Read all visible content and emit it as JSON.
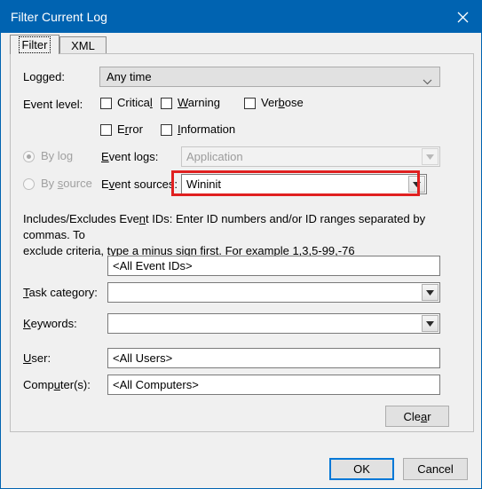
{
  "window": {
    "title": "Filter Current Log",
    "close_icon": "close-icon",
    "accent_color": "#0063b1"
  },
  "tabs": [
    {
      "label": "Filter",
      "active": true
    },
    {
      "label": "XML",
      "active": false
    }
  ],
  "form": {
    "logged": {
      "label": "Logged:",
      "value": "Any time",
      "chevron_icon": "chevron-down-icon"
    },
    "event_level": {
      "label": "Event level:",
      "options": [
        {
          "label": "Critical",
          "accel": "l",
          "checked": false
        },
        {
          "label": "Warning",
          "accel": "W",
          "checked": false
        },
        {
          "label": "Verbose",
          "accel": "b",
          "checked": false
        },
        {
          "label": "Error",
          "accel": "r",
          "checked": false
        },
        {
          "label": "Information",
          "accel": "I",
          "checked": false
        }
      ]
    },
    "source_mode": {
      "by_log": {
        "label": "By log",
        "accel": "g",
        "selected": true,
        "disabled": true
      },
      "by_source": {
        "label": "By source",
        "accel": "s",
        "selected": false,
        "disabled": true
      }
    },
    "event_logs": {
      "label": "Event logs:",
      "accel": "E",
      "value": "Application",
      "disabled": true,
      "dropdown_icon": "dropdown-arrow-icon"
    },
    "event_sources": {
      "label": "Event sources:",
      "accel": "v",
      "value": "Wininit",
      "disabled": false,
      "dropdown_icon": "dropdown-arrow-icon",
      "highlight_color": "#e02020"
    },
    "event_ids": {
      "description_line1": "Includes/Excludes Event IDs: Enter ID numbers and/or ID ranges separated by commas. To",
      "description_line2": "exclude criteria, type a minus sign first. For example 1,3,5-99,-76",
      "value": "<All Event IDs>"
    },
    "task_category": {
      "label": "Task category:",
      "accel": "T",
      "value": "",
      "dropdown_icon": "dropdown-arrow-icon"
    },
    "keywords": {
      "label": "Keywords:",
      "accel": "K",
      "value": "",
      "dropdown_icon": "dropdown-arrow-icon"
    },
    "user": {
      "label": "User:",
      "accel": "U",
      "value": "<All Users>"
    },
    "computers": {
      "label": "Computer(s):",
      "accel": "u",
      "value": "<All Computers>"
    },
    "clear_button": "Clear"
  },
  "footer": {
    "ok_label": "OK",
    "cancel_label": "Cancel"
  }
}
